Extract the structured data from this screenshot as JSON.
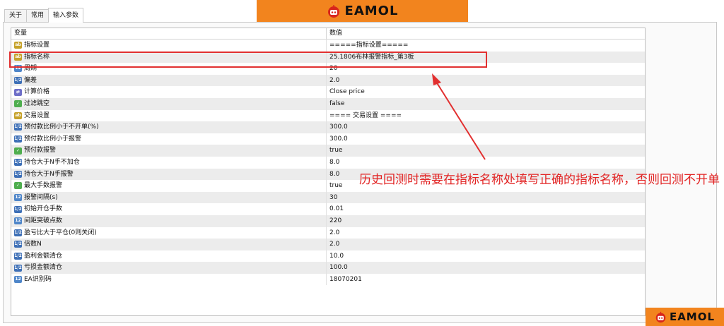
{
  "tabs": [
    "关于",
    "常用",
    "输入参数"
  ],
  "active_tab": 2,
  "banner_logo_text": "EAMOL",
  "watermark_logo_text": "EAMOL",
  "table": {
    "header": {
      "variable": "变量",
      "value": "数值"
    },
    "rows": [
      {
        "icon": "ab",
        "name": "指标设置",
        "value": "=====指标设置====="
      },
      {
        "icon": "ab",
        "name": "指标名称",
        "value": "25.1806布林报警指标_第3板"
      },
      {
        "icon": "num",
        "name": "周期",
        "value": "20"
      },
      {
        "icon": "flt",
        "name": "偏差",
        "value": "2.0"
      },
      {
        "icon": "en",
        "name": "计算价格",
        "value": "Close price"
      },
      {
        "icon": "bool",
        "name": "过滤跳空",
        "value": "false"
      },
      {
        "icon": "ab",
        "name": "交易设置",
        "value": "==== 交易设置 ===="
      },
      {
        "icon": "flt",
        "name": "预付款比例小于不开单(%)",
        "value": "300.0"
      },
      {
        "icon": "flt",
        "name": "预付款比例小于报警",
        "value": "300.0"
      },
      {
        "icon": "bool",
        "name": "预付款报警",
        "value": "true"
      },
      {
        "icon": "flt",
        "name": "持仓大于N手不加仓",
        "value": "8.0"
      },
      {
        "icon": "flt",
        "name": "持仓大于N手报警",
        "value": "8.0"
      },
      {
        "icon": "bool",
        "name": "最大手数报警",
        "value": "true"
      },
      {
        "icon": "num",
        "name": "报警间隔(s)",
        "value": "30"
      },
      {
        "icon": "flt",
        "name": "初始开仓手数",
        "value": "0.01"
      },
      {
        "icon": "num",
        "name": "间距突破点数",
        "value": "220"
      },
      {
        "icon": "flt",
        "name": "盈亏比大于平仓(0则关闭)",
        "value": "2.0"
      },
      {
        "icon": "flt",
        "name": "倍数N",
        "value": "2.0"
      },
      {
        "icon": "flt",
        "name": "盈利金额清仓",
        "value": "10.0"
      },
      {
        "icon": "flt",
        "name": "亏损金额清仓",
        "value": "100.0"
      },
      {
        "icon": "num",
        "name": "EA识别码",
        "value": "18070201"
      }
    ]
  },
  "annotation": "历史回测时需要在指标名称处填写正确的指标名称，否则回测不开单",
  "colors": {
    "accent": "#f2841e",
    "highlight": "#e23030",
    "annotation": "#e22424"
  }
}
